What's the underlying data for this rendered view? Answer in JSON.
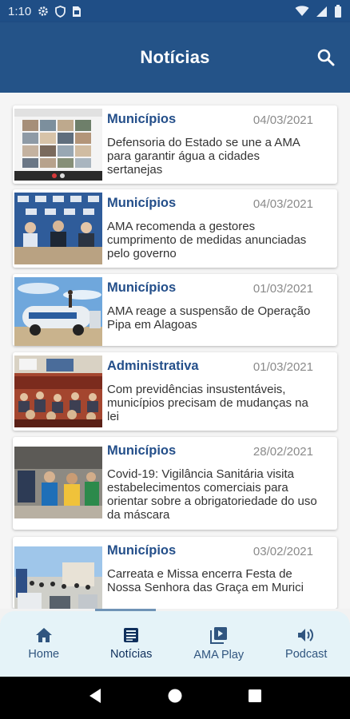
{
  "status_bar": {
    "time": "1:10"
  },
  "header": {
    "title": "Notícias"
  },
  "news": [
    {
      "category": "Municípios",
      "date": "04/03/2021",
      "text": "Defensoria do Estado se une a AMA para garantir água a cidades sertanejas"
    },
    {
      "category": "Municípios",
      "date": "04/03/2021",
      "text": "AMA recomenda a gestores cumprimento de medidas anunciadas pelo governo"
    },
    {
      "category": "Municípios",
      "date": "01/03/2021",
      "text": "AMA reage a suspensão de Operação Pipa em Alagoas"
    },
    {
      "category": "Administrativa",
      "date": "01/03/2021",
      "text": "Com previdências insustentáveis, municípios precisam de mudanças na lei"
    },
    {
      "category": "Municípios",
      "date": "28/02/2021",
      "text": "Covid-19: Vigilância Sanitária visita estabelecimentos comerciais para orientar sobre a obrigatoriedade do uso da máscara"
    },
    {
      "category": "Municípios",
      "date": "03/02/2021",
      "text": "Carreata e Missa encerra Festa de Nossa Senhora das Graça em Murici"
    }
  ],
  "bottom_nav": [
    {
      "label": "Home",
      "icon": "home-icon"
    },
    {
      "label": "Notícias",
      "icon": "newspaper-icon",
      "active": true
    },
    {
      "label": "AMA Play",
      "icon": "play-library-icon"
    },
    {
      "label": "Podcast",
      "icon": "speaker-icon"
    }
  ],
  "colors": {
    "primary": "#245388",
    "accent": "#244f8a",
    "nav_bg": "#e5f3f8"
  }
}
